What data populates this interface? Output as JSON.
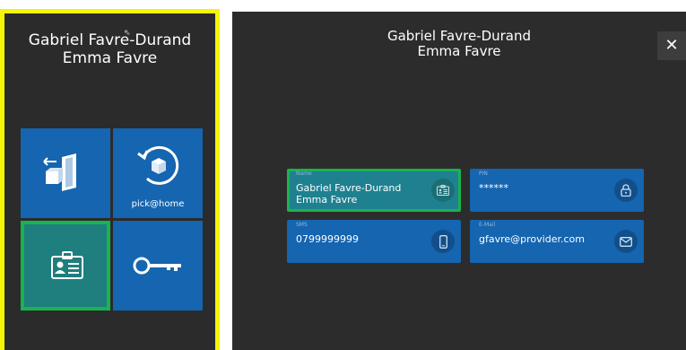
{
  "left_panel": {
    "title_line1": "Gabriel Favre-Durand",
    "title_line2": "Emma Favre",
    "tiles": [
      {
        "label": "",
        "icon": "delivery-door-icon"
      },
      {
        "label": "pick@home",
        "icon": "pick-at-home-icon"
      },
      {
        "label": "",
        "icon": "id-badge-icon",
        "selected": true
      },
      {
        "label": "",
        "icon": "key-icon"
      }
    ]
  },
  "right_panel": {
    "title_line1": "Gabriel Favre-Durand",
    "title_line2": "Emma Favre",
    "close_label": "✕",
    "fields": {
      "name": {
        "label": "Name",
        "value": "Gabriel Favre-Durand\nEmma Favre",
        "icon": "id-card-icon"
      },
      "pin": {
        "label": "PIN",
        "value": "******",
        "icon": "lock-icon"
      },
      "sms": {
        "label": "SMS",
        "value": "0799999999",
        "icon": "mobile-phone-icon"
      },
      "email": {
        "label": "E-Mail",
        "value": "gfavre@provider.com",
        "icon": "envelope-icon"
      }
    }
  },
  "colors": {
    "highlight_yellow": "#f5f50a",
    "selection_green": "#19b350",
    "tile_blue": "#1565b0",
    "panel_dark": "#2b2b2b"
  }
}
